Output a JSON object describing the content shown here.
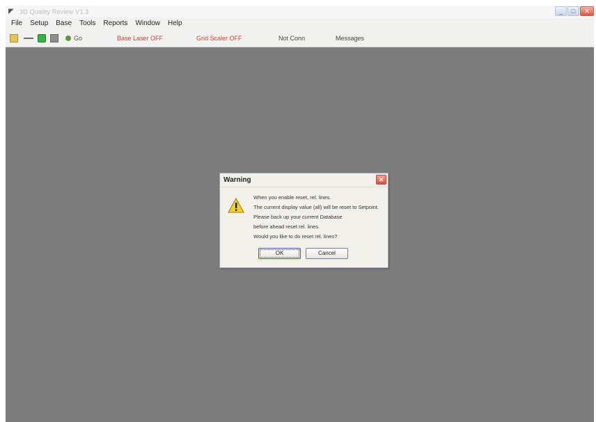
{
  "window": {
    "title": "3D Quality Review V1.3"
  },
  "menu": [
    "File",
    "Setup",
    "Base",
    "Tools",
    "Reports",
    "Window",
    "Help"
  ],
  "toolbar": {
    "connect_label": "Go",
    "status1": "Base Laser OFF",
    "status2": "Grid Scaler OFF",
    "item3": "Not Conn",
    "item4": "Messages"
  },
  "dialog": {
    "title": "Warning",
    "lines": [
      "When you enable reset, rel. lines.",
      "The current display value (all) will be reset to Setpoint.",
      "Please back up your current Database",
      "before ahead reset rel. lines.",
      "Would you like to do reset rel. lines?"
    ],
    "ok_label": "OK",
    "cancel_label": "Cancel"
  },
  "colors": {
    "workspace": "#7c7c7c",
    "status_red": "#e23a2c",
    "warning_yellow": "#f2d21e"
  }
}
